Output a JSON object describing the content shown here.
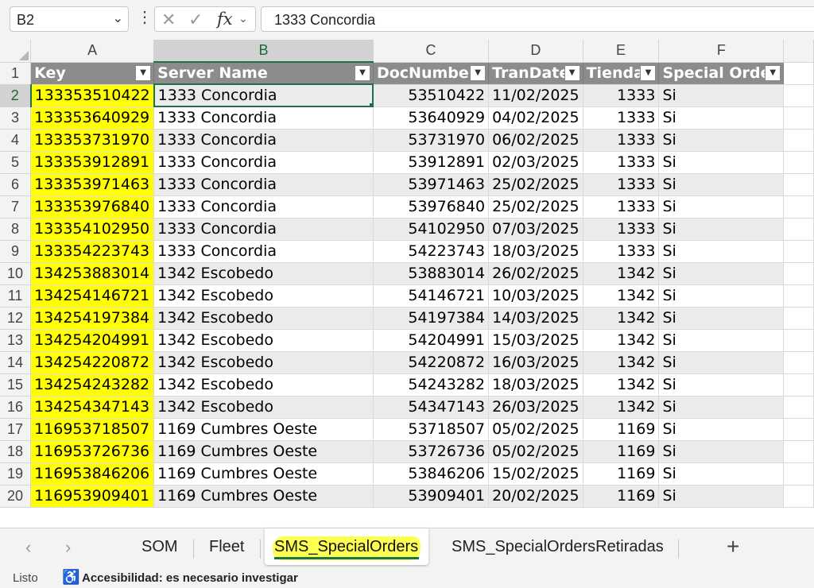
{
  "formula_bar": {
    "name_box": "B2",
    "formula": "1333 Concordia",
    "icons": {
      "more": "vertical-dots-icon",
      "cancel": "x-icon",
      "enter": "checkmark-icon",
      "fx": "function-icon"
    }
  },
  "grid": {
    "columns": [
      "A",
      "B",
      "C",
      "D",
      "E",
      "F"
    ],
    "selected_column": "B",
    "selected_row": 2,
    "active_cell": "B2",
    "header_row": {
      "row": 1,
      "cells": [
        "Key",
        "Server Name",
        "DocNumber",
        "TranDate",
        "Tienda",
        "Special Order"
      ]
    },
    "rows": [
      {
        "n": 2,
        "cells": [
          "133353510422",
          "1333 Concordia",
          "53510422",
          "11/02/2025",
          "1333",
          "Si"
        ]
      },
      {
        "n": 3,
        "cells": [
          "133353640929",
          "1333 Concordia",
          "53640929",
          "04/02/2025",
          "1333",
          "Si"
        ]
      },
      {
        "n": 4,
        "cells": [
          "133353731970",
          "1333 Concordia",
          "53731970",
          "06/02/2025",
          "1333",
          "Si"
        ]
      },
      {
        "n": 5,
        "cells": [
          "133353912891",
          "1333 Concordia",
          "53912891",
          "02/03/2025",
          "1333",
          "Si"
        ]
      },
      {
        "n": 6,
        "cells": [
          "133353971463",
          "1333 Concordia",
          "53971463",
          "25/02/2025",
          "1333",
          "Si"
        ]
      },
      {
        "n": 7,
        "cells": [
          "133353976840",
          "1333 Concordia",
          "53976840",
          "25/02/2025",
          "1333",
          "Si"
        ]
      },
      {
        "n": 8,
        "cells": [
          "133354102950",
          "1333 Concordia",
          "54102950",
          "07/03/2025",
          "1333",
          "Si"
        ]
      },
      {
        "n": 9,
        "cells": [
          "133354223743",
          "1333 Concordia",
          "54223743",
          "18/03/2025",
          "1333",
          "Si"
        ]
      },
      {
        "n": 10,
        "cells": [
          "134253883014",
          "1342 Escobedo",
          "53883014",
          "26/02/2025",
          "1342",
          "Si"
        ]
      },
      {
        "n": 11,
        "cells": [
          "134254146721",
          "1342 Escobedo",
          "54146721",
          "10/03/2025",
          "1342",
          "Si"
        ]
      },
      {
        "n": 12,
        "cells": [
          "134254197384",
          "1342 Escobedo",
          "54197384",
          "14/03/2025",
          "1342",
          "Si"
        ]
      },
      {
        "n": 13,
        "cells": [
          "134254204991",
          "1342 Escobedo",
          "54204991",
          "15/03/2025",
          "1342",
          "Si"
        ]
      },
      {
        "n": 14,
        "cells": [
          "134254220872",
          "1342 Escobedo",
          "54220872",
          "16/03/2025",
          "1342",
          "Si"
        ]
      },
      {
        "n": 15,
        "cells": [
          "134254243282",
          "1342 Escobedo",
          "54243282",
          "18/03/2025",
          "1342",
          "Si"
        ]
      },
      {
        "n": 16,
        "cells": [
          "134254347143",
          "1342 Escobedo",
          "54347143",
          "26/03/2025",
          "1342",
          "Si"
        ]
      },
      {
        "n": 17,
        "cells": [
          "116953718507",
          "1169 Cumbres Oeste",
          "53718507",
          "05/02/2025",
          "1169",
          "Si"
        ]
      },
      {
        "n": 18,
        "cells": [
          "116953726736",
          "1169 Cumbres Oeste",
          "53726736",
          "05/02/2025",
          "1169",
          "Si"
        ]
      },
      {
        "n": 19,
        "cells": [
          "116953846206",
          "1169 Cumbres Oeste",
          "53846206",
          "15/02/2025",
          "1169",
          "Si"
        ]
      },
      {
        "n": 20,
        "cells": [
          "116953909401",
          "1169 Cumbres Oeste",
          "53909401",
          "20/02/2025",
          "1169",
          "Si"
        ]
      }
    ],
    "colors": {
      "key_highlight": "#ffff00",
      "header_fill": "#8c8c8c",
      "band_fill": "#ebebeb",
      "selection": "#1e7145"
    }
  },
  "sheet_tabs": {
    "tabs": [
      "SOM",
      "Fleet",
      "SMS_SpecialOrders",
      "SMS_SpecialOrdersRetiradas"
    ],
    "active": "SMS_SpecialOrders"
  },
  "status_bar": {
    "ready": "Listo",
    "accessibility": "Accesibilidad: es necesario investigar"
  }
}
